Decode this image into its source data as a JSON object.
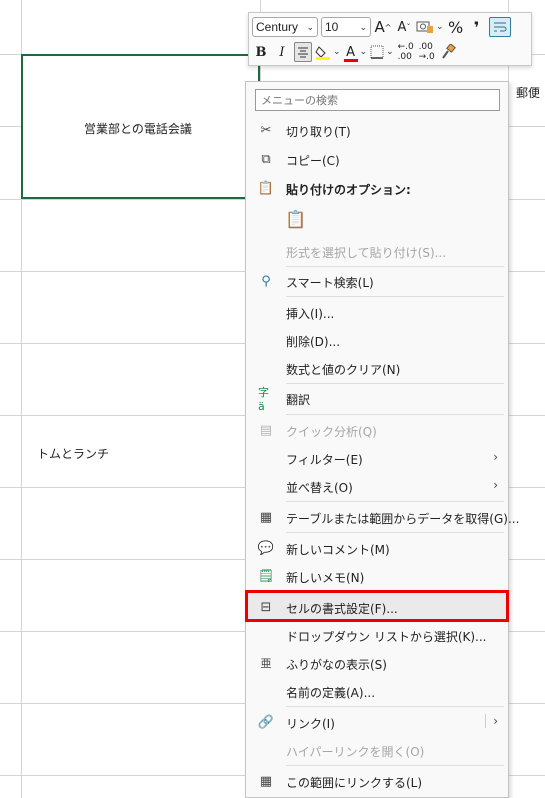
{
  "sheet": {
    "cells": {
      "meeting": "営業部との電話会議",
      "lunch": "トムとランチ",
      "right_fragment": "郵便"
    }
  },
  "mini_toolbar": {
    "font_name": "Century",
    "font_size": "10",
    "increase_font": "A",
    "decrease_font": "A",
    "percent": "%",
    "comma": "❜",
    "bold": "B",
    "italic": "I",
    "font_color": "A"
  },
  "context_menu": {
    "search_placeholder": "メニューの検索",
    "items": {
      "cut": "切り取り(T)",
      "copy": "コピー(C)",
      "paste_options": "貼り付けのオプション:",
      "paste_special": "形式を選択して貼り付け(S)...",
      "smart_lookup": "スマート検索(L)",
      "insert": "挿入(I)...",
      "delete": "削除(D)...",
      "clear": "数式と値のクリア(N)",
      "translate": "翻訳",
      "quick_analysis": "クイック分析(Q)",
      "filter": "フィルター(E)",
      "sort": "並べ替え(O)",
      "get_data": "テーブルまたは範囲からデータを取得(G)...",
      "new_comment": "新しいコメント(M)",
      "new_note": "新しいメモ(N)",
      "format_cells": "セルの書式設定(F)...",
      "dropdown": "ドロップダウン リストから選択(K)...",
      "phonetic": "ふりがなの表示(S)",
      "define_name": "名前の定義(A)...",
      "link": "リンク(I)",
      "open_hyperlink": "ハイパーリンクを開く(O)",
      "link_to_range": "この範囲にリンクする(L)"
    }
  },
  "colors": {
    "selection_border": "#1e6a3c",
    "highlight": "#ee0000",
    "fill_color": "#ffff00",
    "font_color": "#ee0000"
  }
}
